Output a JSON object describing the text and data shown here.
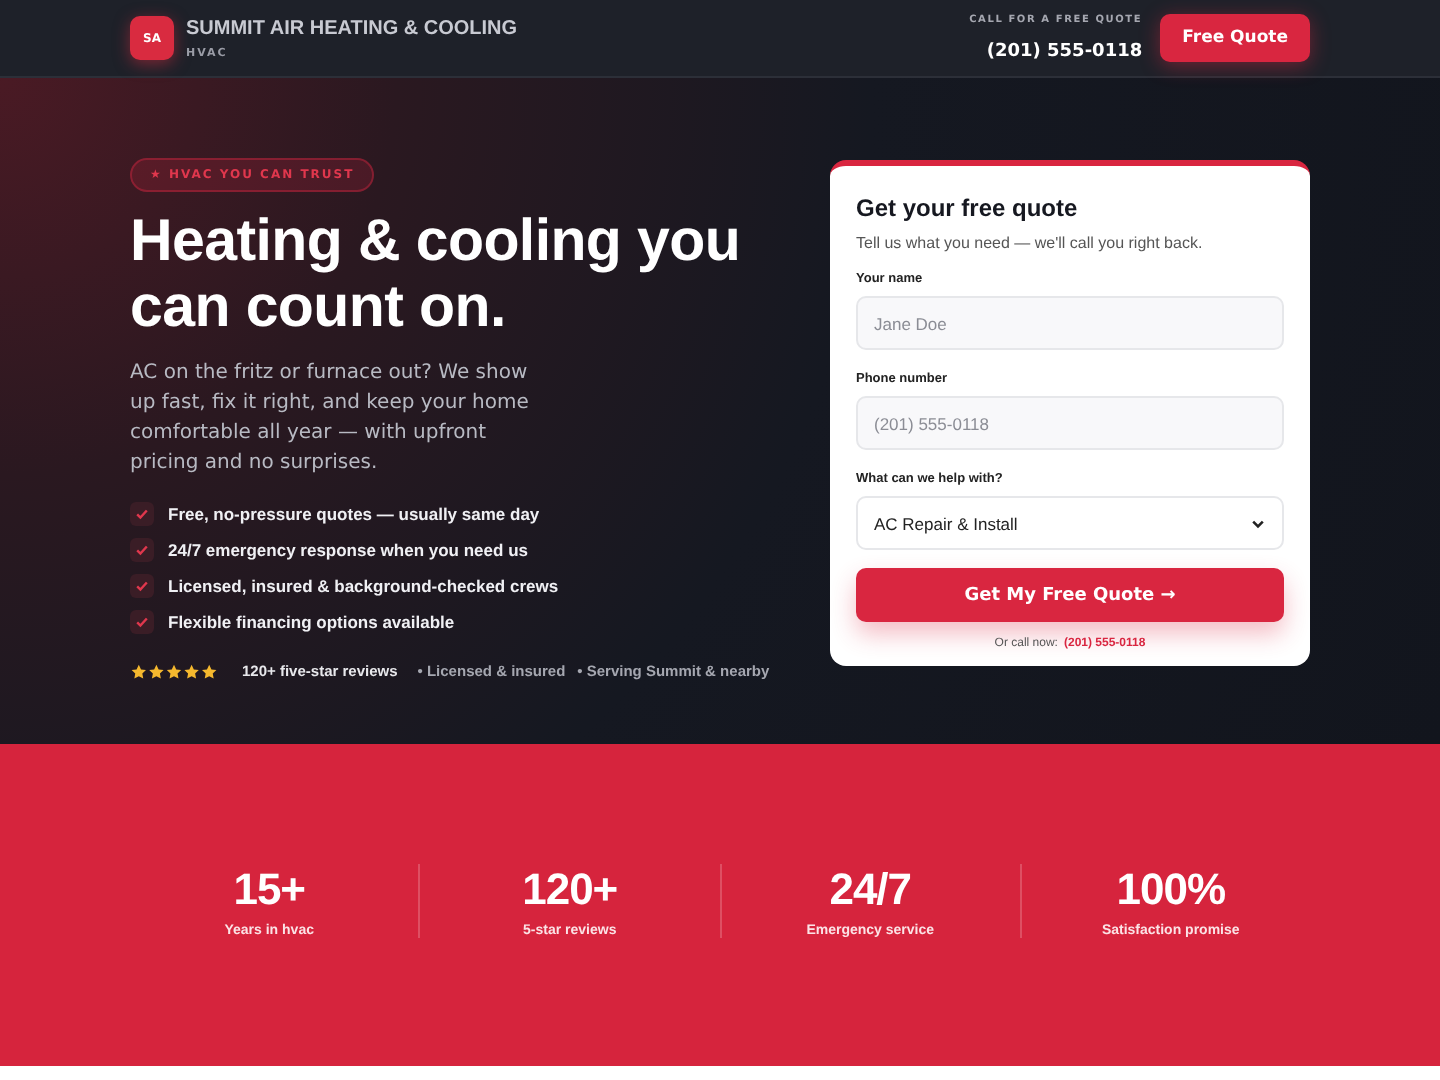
{
  "header": {
    "logo": "SA",
    "brand": "SUMMIT AIR HEATING & COOLING",
    "tagline": "HVAC",
    "call_label": "CALL FOR A FREE QUOTE",
    "phone": "(201) 555-0118",
    "button": "Free Quote"
  },
  "hero": {
    "badge": "★ HVAC YOU CAN TRUST",
    "title": "Heating & cooling you can count on.",
    "intro": "AC on the fritz or furnace out? We show up fast, fix it right, and keep your home comfortable all year — with upfront pricing and no surprises.",
    "features": [
      {
        "text": "Free, no-pressure quotes — usually same day",
        "checked": true
      },
      {
        "text": "24/7 emergency response when you need us",
        "checked": true
      },
      {
        "text": "Licensed, insured & background-checked crews",
        "checked": true
      },
      {
        "text": "Flexible financing options available",
        "checked": true
      }
    ],
    "rating": {
      "stars": 5,
      "reviews": "120+ five-star reviews"
    },
    "trust": [
      "• Licensed & insured",
      "• Serving Summit & nearby"
    ]
  },
  "quote_form": {
    "title": "Get your free quote",
    "subtitle": "Tell us what you need — we'll call you right back.",
    "fields": [
      {
        "kind": "text",
        "label": "Your name",
        "placeholder": "Jane Doe"
      },
      {
        "kind": "text",
        "label": "Phone number",
        "placeholder": "(201) 555-0118"
      },
      {
        "kind": "select",
        "label": "What can we help with?",
        "value": "AC Repair & Install"
      }
    ],
    "submit": "Get My Free Quote →",
    "call_prefix": "Or call now:",
    "call_phone": "(201) 555-0118"
  },
  "stats": [
    {
      "value": "15+",
      "label": "Years in hvac"
    },
    {
      "value": "120+",
      "label": "5-star reviews"
    },
    {
      "value": "24/7",
      "label": "Emergency service"
    },
    {
      "value": "100%",
      "label": "Satisfaction promise"
    }
  ]
}
